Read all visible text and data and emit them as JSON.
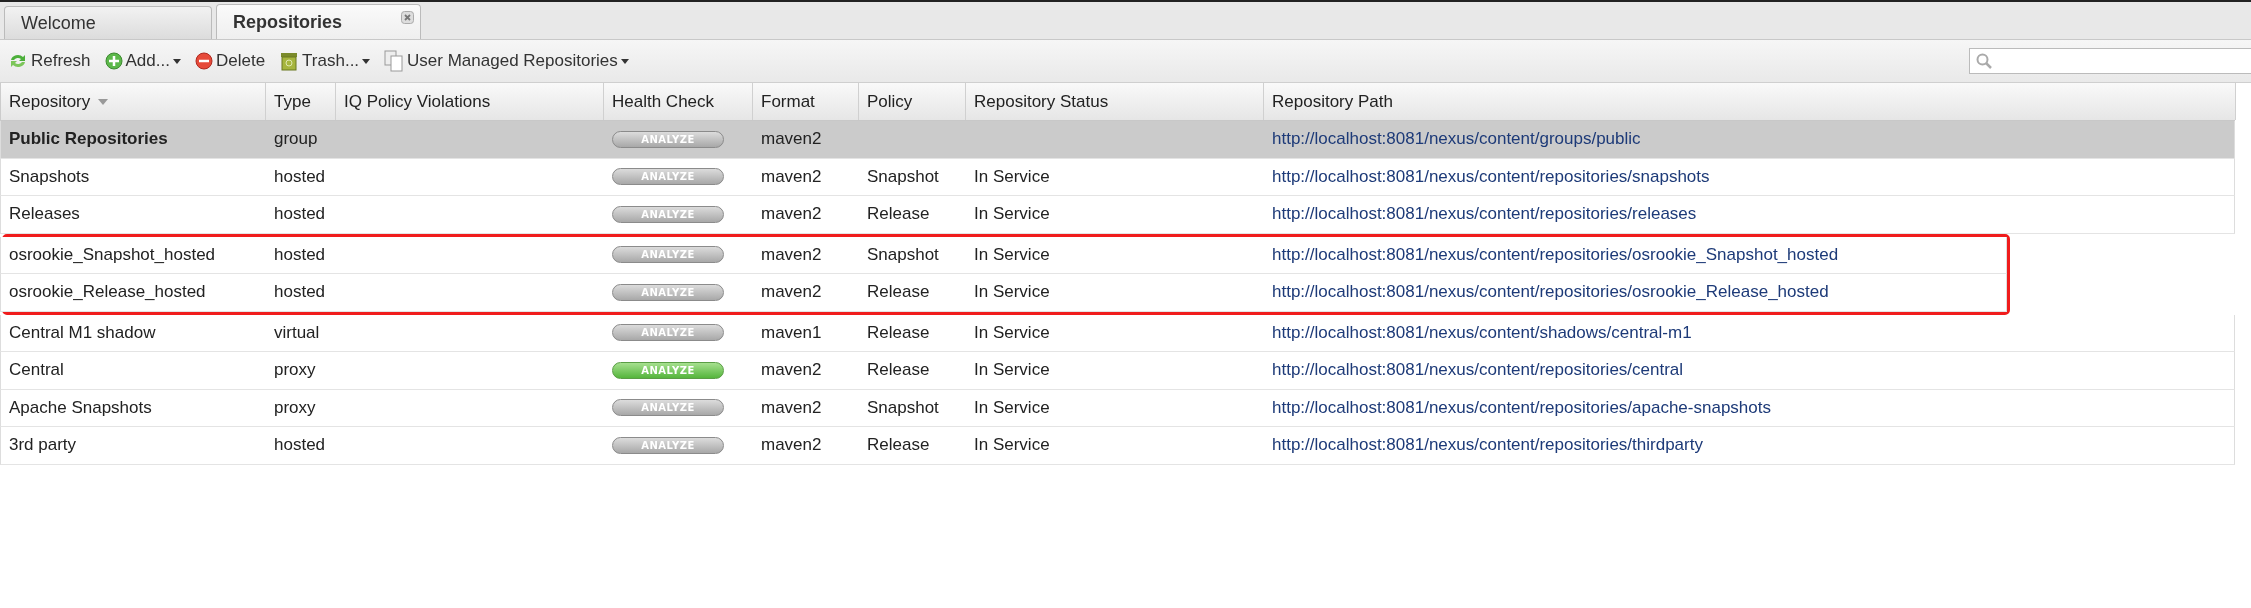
{
  "tabs": [
    {
      "label": "Welcome",
      "selected": false,
      "closable": false
    },
    {
      "label": "Repositories",
      "selected": true,
      "closable": true
    }
  ],
  "toolbar": [
    {
      "label": "Refresh",
      "dropdown": false
    },
    {
      "label": "Add...",
      "dropdown": true
    },
    {
      "label": "Delete",
      "dropdown": false
    },
    {
      "label": "Trash...",
      "dropdown": true
    },
    {
      "label": "User Managed Repositories",
      "dropdown": true
    }
  ],
  "table": {
    "columns": [
      {
        "label": "Repository",
        "sorted": true
      },
      {
        "label": "Type",
        "sorted": false
      },
      {
        "label": "IQ Policy Violations",
        "sorted": false
      },
      {
        "label": "Health Check",
        "sorted": false
      },
      {
        "label": "Format",
        "sorted": false
      },
      {
        "label": "Policy",
        "sorted": false
      },
      {
        "label": "Repository Status",
        "sorted": false
      },
      {
        "label": "Repository Path",
        "sorted": false
      }
    ],
    "rows": [
      {
        "repository": "Public Repositories",
        "type": "group",
        "health_check": "ANALYZE",
        "health_active": false,
        "format": "maven2",
        "path": "http://localhost:8081/nexus/content/groups/public",
        "selected": true,
        "annotated": false
      },
      {
        "repository": "Snapshots",
        "type": "hosted",
        "health_check": "ANALYZE",
        "health_active": false,
        "format": "maven2",
        "policy": "Snapshot",
        "status": "In Service",
        "path": "http://localhost:8081/nexus/content/repositories/snapshots",
        "selected": false,
        "annotated": false
      },
      {
        "repository": "Releases",
        "type": "hosted",
        "health_check": "ANALYZE",
        "health_active": false,
        "format": "maven2",
        "policy": "Release",
        "status": "In Service",
        "path": "http://localhost:8081/nexus/content/repositories/releases",
        "selected": false,
        "annotated": false
      },
      {
        "repository": "osrookie_Snapshot_hosted",
        "type": "hosted",
        "health_check": "ANALYZE",
        "health_active": false,
        "format": "maven2",
        "policy": "Snapshot",
        "status": "In Service",
        "path": "http://localhost:8081/nexus/content/repositories/osrookie_Snapshot_hosted",
        "selected": false,
        "annotated": true
      },
      {
        "repository": "osrookie_Release_hosted",
        "type": "hosted",
        "health_check": "ANALYZE",
        "health_active": false,
        "format": "maven2",
        "policy": "Release",
        "status": "In Service",
        "path": "http://localhost:8081/nexus/content/repositories/osrookie_Release_hosted",
        "selected": false,
        "annotated": true
      },
      {
        "repository": "Central M1 shadow",
        "type": "virtual",
        "health_check": "ANALYZE",
        "health_active": false,
        "format": "maven1",
        "policy": "Release",
        "status": "In Service",
        "path": "http://localhost:8081/nexus/content/shadows/central-m1",
        "selected": false,
        "annotated": false
      },
      {
        "repository": "Central",
        "type": "proxy",
        "health_check": "ANALYZE",
        "health_active": true,
        "format": "maven2",
        "policy": "Release",
        "status": "In Service",
        "path": "http://localhost:8081/nexus/content/repositories/central",
        "selected": false,
        "annotated": false
      },
      {
        "repository": "Apache Snapshots",
        "type": "proxy",
        "health_check": "ANALYZE",
        "health_active": false,
        "format": "maven2",
        "policy": "Snapshot",
        "status": "In Service",
        "path": "http://localhost:8081/nexus/content/repositories/apache-snapshots",
        "selected": false,
        "annotated": false
      },
      {
        "repository": "3rd party",
        "type": "hosted",
        "health_check": "ANALYZE",
        "health_active": false,
        "format": "maven2",
        "policy": "Release",
        "status": "In Service",
        "path": "http://localhost:8081/nexus/content/repositories/thirdparty",
        "selected": false,
        "annotated": false
      }
    ]
  }
}
